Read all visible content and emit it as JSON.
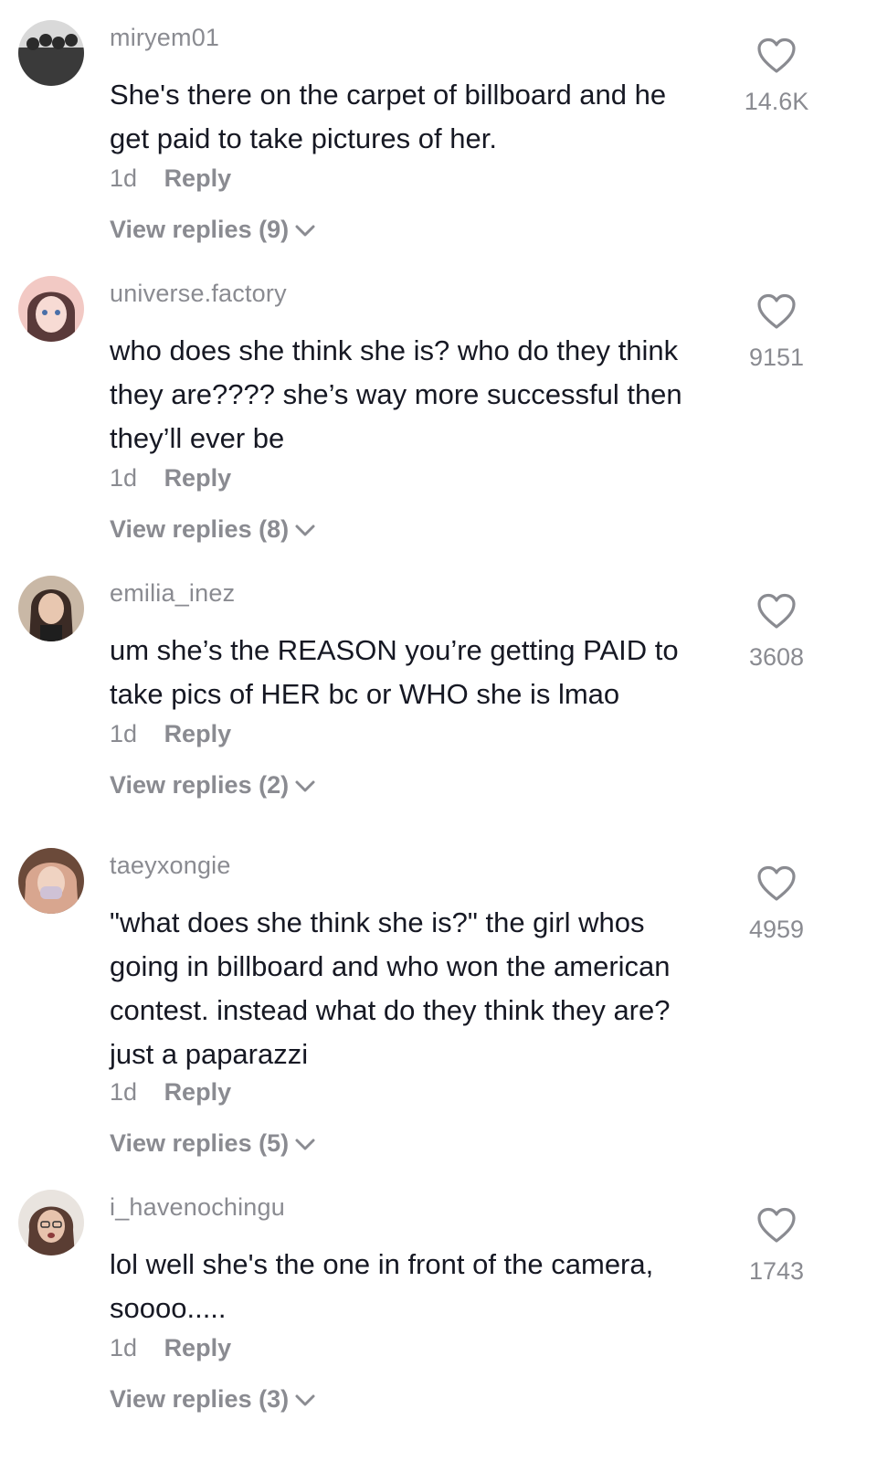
{
  "comments": [
    {
      "username": "miryem01",
      "text": "She's there on the carpet of billboard and he\nget paid to take pictures of her.",
      "time": "1d",
      "reply_label": "Reply",
      "view_replies": "View replies (9)",
      "likes": "14.6K",
      "avatar_colors": [
        "#3a3a3a",
        "#d9d9d9"
      ]
    },
    {
      "username": "universe.factory",
      "text": "who does she think she is? who do they think\nthey are???? she’s way more successful then\nthey’ll ever be",
      "time": "1d",
      "reply_label": "Reply",
      "view_replies": "View replies (8)",
      "likes": "9151",
      "avatar_colors": [
        "#f2c9c4",
        "#5a3a3a"
      ]
    },
    {
      "username": "emilia_inez",
      "text": "um she’s the REASON you’re getting PAID to\ntake pics of HER bc or WHO she is lmao",
      "time": "1d",
      "reply_label": "Reply",
      "view_replies": "View replies (2)",
      "likes": "3608",
      "avatar_colors": [
        "#c9b8a6",
        "#3b2b25"
      ]
    },
    {
      "username": "taeyxongie",
      "text": "\"what does she think she is?\" the girl whos\ngoing in billboard and who won the american\ncontest. instead what do they think they are?\njust a paparazzi",
      "time": "1d",
      "reply_label": "Reply",
      "view_replies": "View replies (5)",
      "likes": "4959",
      "avatar_colors": [
        "#d8a68f",
        "#6b4a3a"
      ]
    },
    {
      "username": "i_havenochingu",
      "text": "lol well she's the one in front of the camera,\nsoooo.....",
      "time": "1d",
      "reply_label": "Reply",
      "view_replies": "View replies (3)",
      "likes": "1743",
      "avatar_colors": [
        "#e9e4df",
        "#5a3d33"
      ]
    }
  ]
}
